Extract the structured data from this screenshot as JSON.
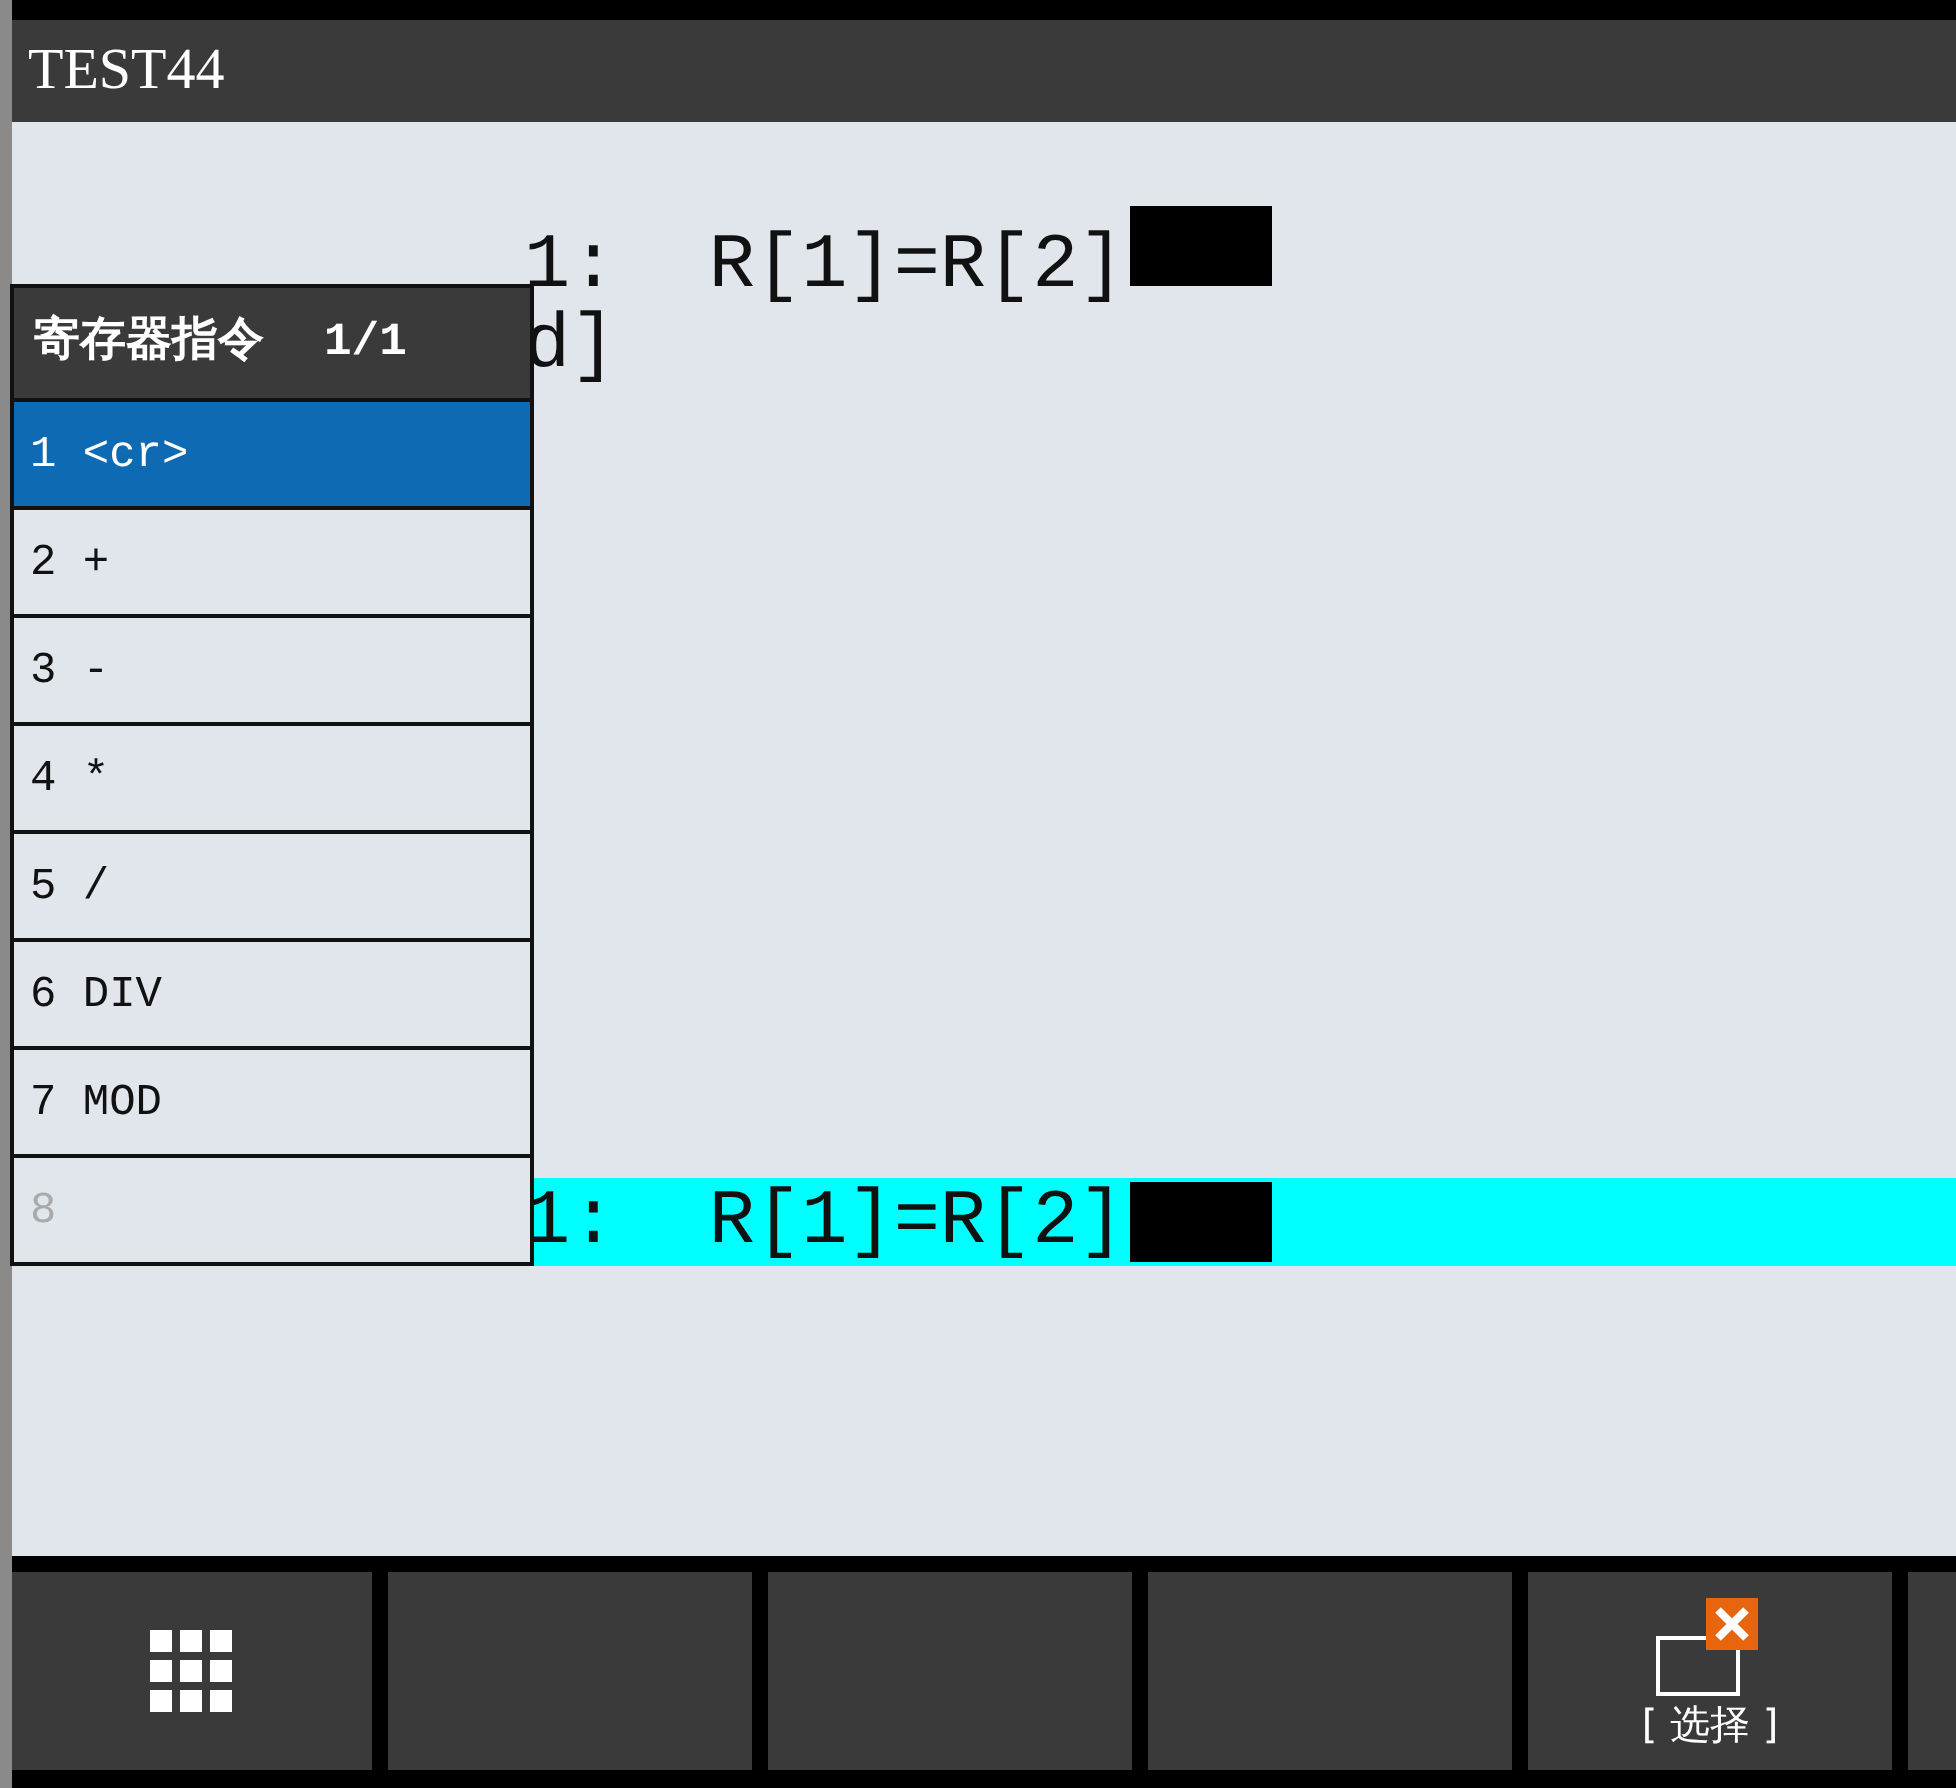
{
  "title": "TEST44",
  "program_lines": [
    {
      "text": "1:  R[1]=R[2]",
      "cursor": true
    },
    {
      "text": "d]",
      "cursor": false
    }
  ],
  "menu": {
    "title": "寄存器指令",
    "page": "1/1",
    "items": [
      {
        "label": "1 <cr>",
        "selected": true,
        "disabled": false
      },
      {
        "label": "2 +",
        "selected": false,
        "disabled": false
      },
      {
        "label": "3 -",
        "selected": false,
        "disabled": false
      },
      {
        "label": "4 *",
        "selected": false,
        "disabled": false
      },
      {
        "label": "5 /",
        "selected": false,
        "disabled": false
      },
      {
        "label": "6 DIV",
        "selected": false,
        "disabled": false
      },
      {
        "label": "7 MOD",
        "selected": false,
        "disabled": false
      },
      {
        "label": "8",
        "selected": false,
        "disabled": true
      }
    ]
  },
  "prompt_line": {
    "text": "1:  R[1]=R[2]",
    "cursor": true
  },
  "softkeys": [
    {
      "kind": "menu"
    },
    {
      "kind": "blank"
    },
    {
      "kind": "blank"
    },
    {
      "kind": "blank"
    },
    {
      "kind": "select",
      "label": "[ 选择 ]"
    },
    {
      "kind": "blank"
    }
  ]
}
